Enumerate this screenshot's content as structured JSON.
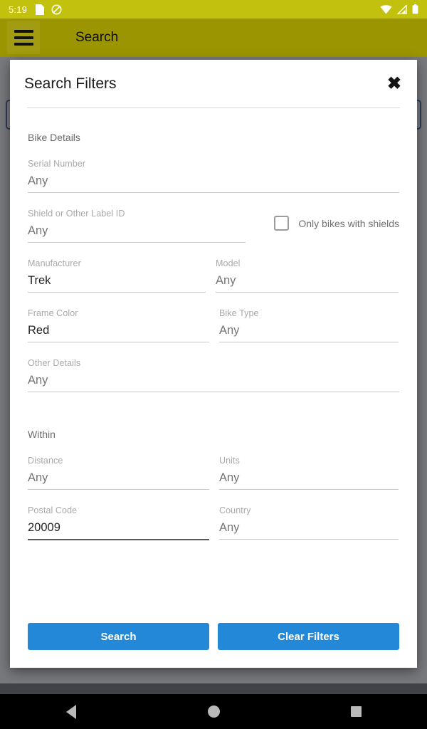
{
  "status_bar": {
    "time": "5:19",
    "left_icons": [
      "sim-card-icon",
      "do-not-disturb-icon"
    ],
    "right_icons": [
      "wifi-icon",
      "cell-signal-icon",
      "battery-icon"
    ],
    "background_color": "#c1c10e"
  },
  "app_bar": {
    "menu_icon": "hamburger-menu-icon",
    "title": "Search",
    "background_color": "#9b9501"
  },
  "dialog": {
    "title": "Search Filters",
    "close_icon": "close-x-icon",
    "sections": [
      {
        "key": "bike_details",
        "title": "Bike Details"
      },
      {
        "key": "within",
        "title": "Within"
      }
    ],
    "fields": {
      "serial_number": {
        "label": "Serial Number",
        "value": "",
        "placeholder": "Any",
        "filled": false,
        "focused": false
      },
      "shield_label_id": {
        "label": "Shield or Other Label ID",
        "value": "",
        "placeholder": "Any",
        "filled": false,
        "focused": false
      },
      "manufacturer": {
        "label": "Manufacturer",
        "value": "Trek",
        "placeholder": "Any",
        "filled": true,
        "focused": false
      },
      "model": {
        "label": "Model",
        "value": "",
        "placeholder": "Any",
        "filled": false,
        "focused": false
      },
      "frame_color": {
        "label": "Frame Color",
        "value": "Red",
        "placeholder": "Any",
        "filled": true,
        "focused": false
      },
      "bike_type": {
        "label": "Bike Type",
        "value": "",
        "placeholder": "Any",
        "filled": false,
        "focused": false
      },
      "other_details": {
        "label": "Other Details",
        "value": "",
        "placeholder": "Any",
        "filled": false,
        "focused": false
      },
      "distance": {
        "label": "Distance",
        "value": "",
        "placeholder": "Any",
        "filled": false,
        "focused": false
      },
      "units": {
        "label": "Units",
        "value": "",
        "placeholder": "Any",
        "filled": false,
        "focused": false
      },
      "postal_code": {
        "label": "Postal Code",
        "value": "20009",
        "placeholder": "Any",
        "filled": true,
        "focused": true
      },
      "country": {
        "label": "Country",
        "value": "",
        "placeholder": "Any",
        "filled": false,
        "focused": false
      }
    },
    "checkbox": {
      "label": "Only bikes with shields",
      "checked": false
    },
    "actions": {
      "search_label": "Search",
      "clear_label": "Clear Filters",
      "accent_color": "#2488d8"
    }
  },
  "nav_bar": {
    "back_icon": "triangle-back-icon",
    "home_icon": "circle-home-icon",
    "recents_icon": "square-recents-icon"
  }
}
